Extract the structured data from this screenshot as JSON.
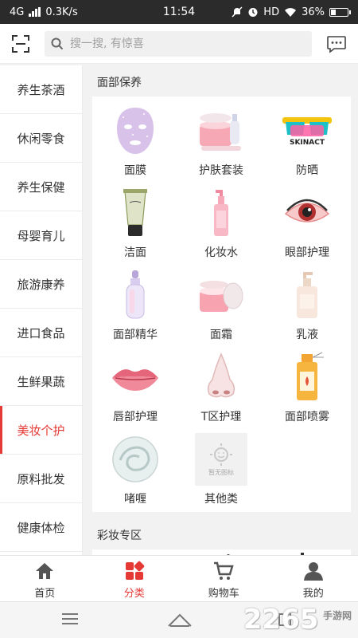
{
  "status_bar": {
    "network": "4G",
    "speed": "0.3K/s",
    "time": "11:54",
    "hd": "HD",
    "battery": "36%",
    "battery_level": 0.36
  },
  "header": {
    "search_placeholder": "搜一搜, 有惊喜"
  },
  "sidebar": {
    "items": [
      {
        "label": "养生茶酒"
      },
      {
        "label": "休闲零食"
      },
      {
        "label": "养生保健"
      },
      {
        "label": "母婴育儿"
      },
      {
        "label": "旅游康养"
      },
      {
        "label": "进口食品"
      },
      {
        "label": "生鲜果蔬"
      },
      {
        "label": "美妆个护"
      },
      {
        "label": "原料批发"
      },
      {
        "label": "健康体检"
      }
    ],
    "active_index": 7
  },
  "sections": [
    {
      "title": "面部保养",
      "items": [
        {
          "label": "面膜",
          "icon": "face-mask-icon"
        },
        {
          "label": "护肤套装",
          "icon": "skincare-set-icon"
        },
        {
          "label": "防晒",
          "icon": "sunglasses-icon"
        },
        {
          "label": "洁面",
          "icon": "cleanser-tube-icon"
        },
        {
          "label": "化妆水",
          "icon": "toner-bottle-icon"
        },
        {
          "label": "眼部护理",
          "icon": "eye-icon"
        },
        {
          "label": "面部精华",
          "icon": "serum-bottle-icon"
        },
        {
          "label": "面霜",
          "icon": "cream-jar-icon"
        },
        {
          "label": "乳液",
          "icon": "lotion-pump-icon"
        },
        {
          "label": "唇部护理",
          "icon": "lips-icon"
        },
        {
          "label": "T区护理",
          "icon": "nose-icon"
        },
        {
          "label": "面部喷雾",
          "icon": "spray-bottle-icon"
        },
        {
          "label": "啫喱",
          "icon": "gel-swirl-icon"
        },
        {
          "label": "其他类",
          "icon": "placeholder-icon",
          "placeholder_text": "暂无图标"
        }
      ]
    },
    {
      "title": "彩妆专区",
      "items": []
    }
  ],
  "sunscreen_label": "SKINACT",
  "bottom_nav": [
    {
      "label": "首页",
      "icon": "home-icon"
    },
    {
      "label": "分类",
      "icon": "category-icon"
    },
    {
      "label": "购物车",
      "icon": "cart-icon"
    },
    {
      "label": "我的",
      "icon": "user-icon"
    }
  ],
  "bottom_nav_active": 1,
  "watermark": {
    "number": "2265",
    "suffix": "手游网"
  },
  "colors": {
    "accent": "#e53935",
    "status_bar": "#2b2b2b"
  }
}
